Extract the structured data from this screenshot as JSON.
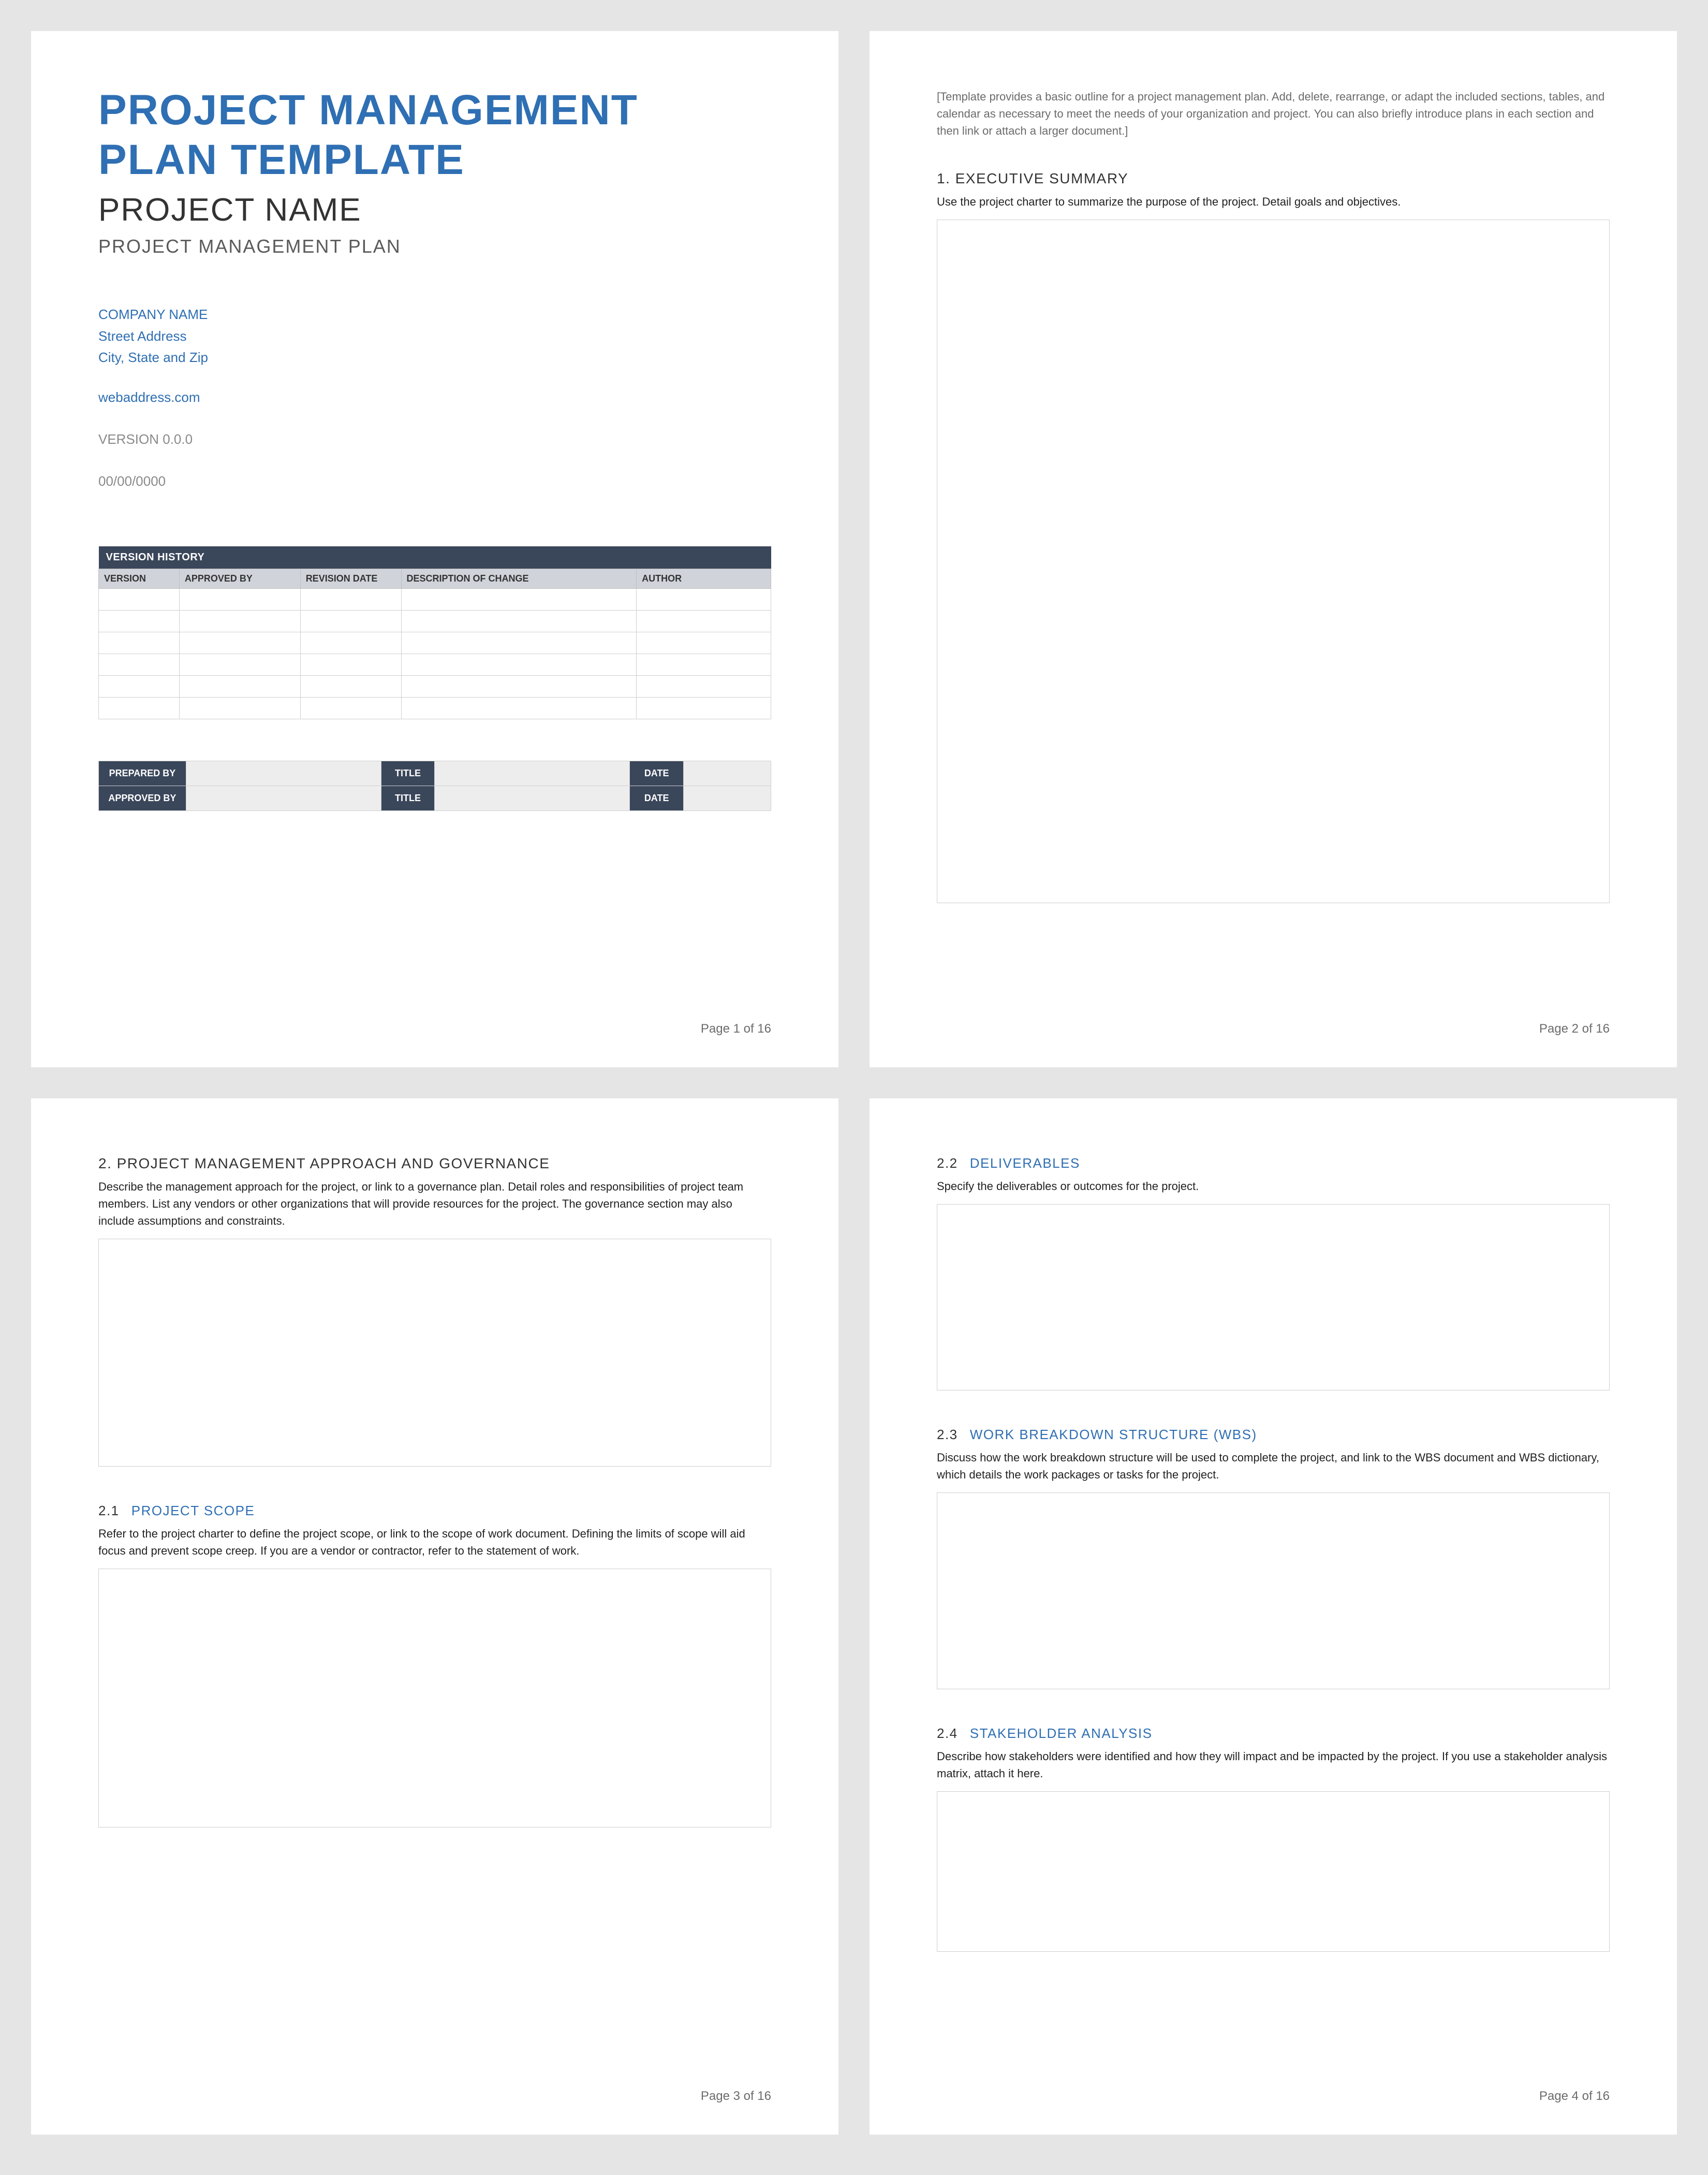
{
  "doc": {
    "title_line1": "PROJECT MANAGEMENT",
    "title_line2": "PLAN TEMPLATE",
    "project_name": "PROJECT NAME",
    "plan_subtitle": "PROJECT MANAGEMENT PLAN",
    "company": {
      "name": "COMPANY NAME",
      "street": "Street Address",
      "citystatezip": "City, State and Zip"
    },
    "web_address": "webaddress.com",
    "version": "VERSION 0.0.0",
    "date": "00/00/0000"
  },
  "version_history": {
    "title": "VERSION HISTORY",
    "headers": {
      "version": "VERSION",
      "approved_by": "APPROVED BY",
      "revision_date": "REVISION DATE",
      "description": "DESCRIPTION OF CHANGE",
      "author": "AUTHOR"
    },
    "row_count": 6
  },
  "signatures": {
    "prepared_by_label": "PREPARED BY",
    "approved_by_label": "APPROVED BY",
    "title_label": "TITLE",
    "date_label": "DATE"
  },
  "page2": {
    "intro_note": "[Template provides a basic outline for a project management plan. Add, delete, rearrange, or adapt the included sections, tables, and calendar as necessary to meet the needs of your organization and project. You can also briefly introduce plans in each section and then link or attach a larger document.]",
    "s1_heading": "1.  EXECUTIVE SUMMARY",
    "s1_desc": "Use the project charter to summarize the purpose of the project. Detail goals and objectives."
  },
  "page3": {
    "s2_heading": "2.  PROJECT MANAGEMENT APPROACH AND GOVERNANCE",
    "s2_desc": "Describe the management approach for the project, or link to a governance plan. Detail roles and responsibilities of project team members. List any vendors or other organizations that will provide resources for the project. The governance section may also include assumptions and constraints.",
    "s21_num": "2.1",
    "s21_heading": "PROJECT SCOPE",
    "s21_desc": "Refer to the project charter to define the project scope, or link to the scope of work document. Defining the limits of scope will aid focus and prevent scope creep. If you are a vendor or contractor, refer to the statement of work."
  },
  "page4": {
    "s22_num": "2.2",
    "s22_heading": "DELIVERABLES",
    "s22_desc": "Specify the deliverables or outcomes for the project.",
    "s23_num": "2.3",
    "s23_heading": "WORK BREAKDOWN STRUCTURE (WBS)",
    "s23_desc": "Discuss how the work breakdown structure will be used to complete the project, and link to the WBS document and WBS dictionary, which details the work packages or tasks for the project.",
    "s24_num": "2.4",
    "s24_heading": "STAKEHOLDER ANALYSIS",
    "s24_desc": "Describe how stakeholders were identified and how they will impact and be impacted by the project. If you use a stakeholder analysis matrix, attach it here."
  },
  "footer": {
    "p1": "Page 1 of 16",
    "p2": "Page 2 of 16",
    "p3": "Page 3 of 16",
    "p4": "Page 4 of 16"
  }
}
